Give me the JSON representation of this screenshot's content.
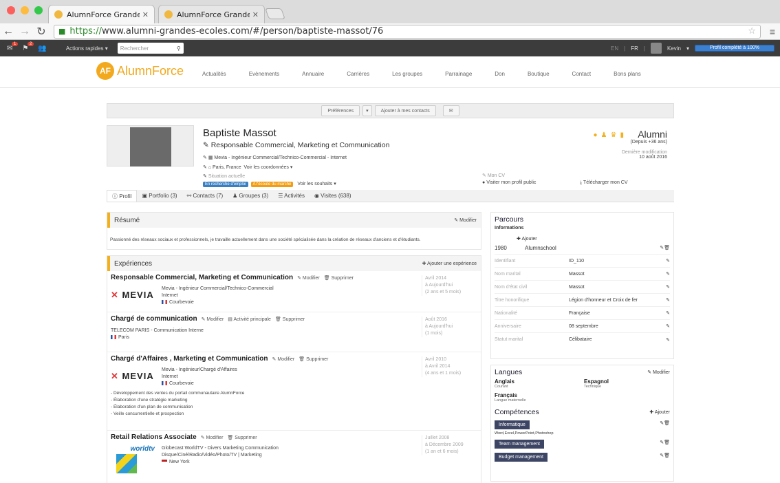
{
  "browser": {
    "tab1_title": "AlumnForce Grandes École",
    "tab2_title": "AlumnForce Grandes École",
    "url_scheme": "https://",
    "url_rest": "www.alumni-grandes-ecoles.com/#/person/baptiste-massot/76"
  },
  "appbar": {
    "mail_count": "1",
    "flag_count": "2",
    "quick_actions": "Actions rapides",
    "search_placeholder": "Rechercher",
    "lang_en": "EN",
    "lang_fr": "FR",
    "user": "Kevin",
    "profile_complete": "Profil complété à 100%"
  },
  "site": {
    "logo": "AlumnForce",
    "nav": [
      "Actualités",
      "Evènements",
      "Annuaire",
      "Carrières",
      "Les groupes",
      "Parrainage",
      "Don",
      "Boutique",
      "Contact",
      "Bons plans"
    ]
  },
  "actions": {
    "preferences": "Préférences",
    "add_contact": "Ajouter à mes contacts"
  },
  "profile": {
    "name": "Baptiste Massot",
    "title": "Responsable Commercial, Marketing et Communication",
    "company_line": "Mevia - Ingénieur Commercial/Technico-Commercial - Internet",
    "location": "Paris, France",
    "see_coords": "Voir les coordonnées",
    "situation": "Situation actuelle",
    "tag1": "En recherche d'emploi",
    "tag2": "A l'écoute du marché",
    "see_wishes": "Voir les souhaits",
    "status": "Alumni",
    "since": "(Depuis +36 ans)",
    "last_mod_label": "Dernière modification",
    "last_mod_date": "10 août 2016",
    "my_cv": "Mon CV",
    "public_profile": "Visiter mon profil public",
    "download_cv": "Télécharger mon CV"
  },
  "tabs": [
    "Profil",
    "Portfolio (3)",
    "Contacts (7)",
    "Groupes (3)",
    "Activités",
    "Visites (638)"
  ],
  "resume": {
    "title": "Résumé",
    "modify": "Modifier",
    "text": "Passionné des réseaux sociaux et professionnels, je travaille actuellement dans une société spécialisée dans la création de réseaux d'anciens et d'étudiants."
  },
  "experiences": {
    "title": "Expériences",
    "add": "Ajouter une expérience",
    "items": [
      {
        "title": "Responsable Commercial, Marketing et Communication",
        "company": "Mevia",
        "role": " - Ingénieur Commercial/Technico-Commercial",
        "sector": "Internet",
        "city": "Courbevoie",
        "d1": "Avril 2014",
        "d2": "à Aujourd'hui",
        "d3": "(2 ans et 5 mois)"
      },
      {
        "title": "Chargé de communication",
        "company": "TELECOM PARIS",
        "role": " - Communication Interne",
        "sector": "",
        "city": "Paris",
        "d1": "Août 2016",
        "d2": "à Aujourd'hui",
        "d3": "(1 mois)"
      },
      {
        "title": "Chargé d'Affaires , Marketing et Communication",
        "company": "Mevia",
        "role": " - Ingénieur/Chargé d'Affaires",
        "sector": "Internet",
        "city": "Courbevoie",
        "d1": "Avril 2010",
        "d2": "à Avril 2014",
        "d3": "(4 ans et 1 mois)"
      },
      {
        "title": "Retail Relations Associate",
        "company": "Globecast WorldTV",
        "role": " - Divers Marketing Communication",
        "sector": "Disque/Ciné/Radio/Vidéo/Photo/TV | Marketing",
        "city": "New York",
        "d1": "Juillet 2008",
        "d2": "à Décembre 2009",
        "d3": "(1 an et 6 mois)"
      }
    ],
    "bullets": [
      "- Développement des ventes du portail communautaire AlumnForce",
      "- Élaboration d'une stratégie marketing",
      "- Élaboration d'un plan de communication",
      "- Veille concurrentielle et prospection"
    ],
    "modify": "Modifier",
    "delete": "Supprimer",
    "main_activity": "Activité principale",
    "mevia_logo": "MEVIA",
    "worldtv_logo": "worldtv"
  },
  "parcours": {
    "title": "Parcours",
    "info": "Informations",
    "add": "Ajouter",
    "year": "1980",
    "school": "Alumnschool",
    "fields": [
      {
        "k": "Identifiant",
        "v": "ID_110"
      },
      {
        "k": "Nom marital",
        "v": "Massot"
      },
      {
        "k": "Nom d'état civil",
        "v": "Massot"
      },
      {
        "k": "Titre honorifique",
        "v": "Légion d'honneur et Croix de fer"
      },
      {
        "k": "Nationalité",
        "v": "Française"
      },
      {
        "k": "Anniversaire",
        "v": "08 septembre"
      },
      {
        "k": "Statut marital",
        "v": "Célibataire"
      }
    ]
  },
  "langues": {
    "title": "Langues",
    "modify": "Modifier",
    "items": [
      {
        "name": "Anglais",
        "level": "Courant"
      },
      {
        "name": "Espagnol",
        "level": "Technique"
      },
      {
        "name": "Français",
        "level": "Langue maternelle"
      }
    ]
  },
  "competences": {
    "title": "Compétences",
    "add": "Ajouter",
    "skills": [
      "Informatique",
      "Team management",
      "Budget management"
    ],
    "skill1_detail": "Word,Excel,PowerPoint,Photoshop"
  },
  "colors": {
    "accent": "#f2a91d",
    "skill": "#3d4564",
    "progress": "#3a7fd0"
  }
}
